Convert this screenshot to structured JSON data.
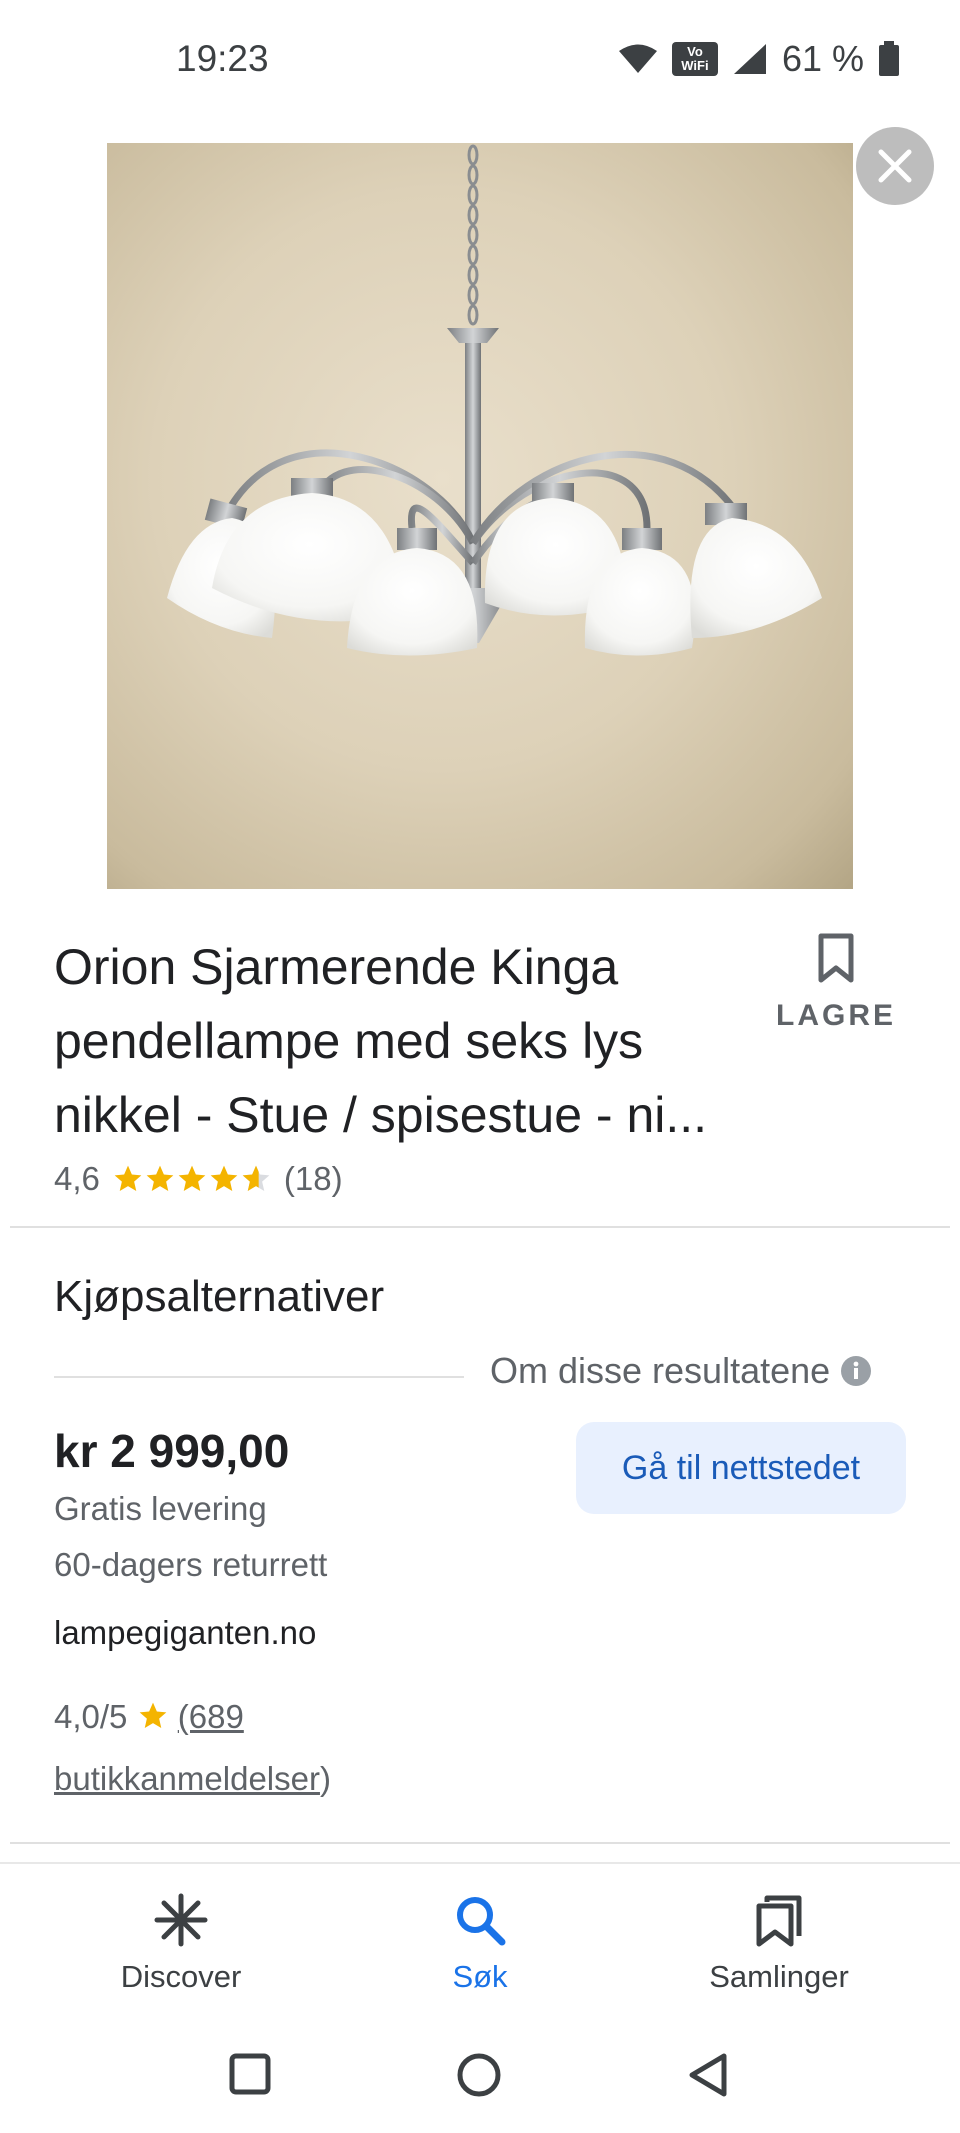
{
  "status_bar": {
    "time": "19:23",
    "vowifi_top": "Vo",
    "vowifi_bottom": "WiFi",
    "battery": "61 %"
  },
  "product": {
    "title": "Orion Sjarmerende Kinga pendellampe med seks lys nikkel - Stue / spisestue - ni...",
    "rating": "4,6",
    "rating_value": 4.6,
    "review_count": "(18)",
    "save_label": "LAGRE"
  },
  "buying_options": {
    "heading": "Kjøpsalternativer",
    "about_results": "Om disse resultatene"
  },
  "offer": {
    "price": "kr 2 999,00",
    "delivery": "Gratis levering",
    "returns": "60-dagers returrett",
    "store": "lampegiganten.no",
    "store_rating": "4,0/5",
    "store_reviews_link": "(689 butikkanmeldelser",
    "store_reviews_close": ")",
    "visit_button": "Gå til nettstedet"
  },
  "bottom_nav": {
    "items": [
      {
        "label": "Discover",
        "icon": "asterisk-icon",
        "active": false
      },
      {
        "label": "Søk",
        "icon": "search-icon",
        "active": true
      },
      {
        "label": "Samlinger",
        "icon": "collections-icon",
        "active": false
      }
    ]
  },
  "colors": {
    "accent": "#1a73e8",
    "star": "#f4b400",
    "button_bg": "#e8f0fe"
  }
}
